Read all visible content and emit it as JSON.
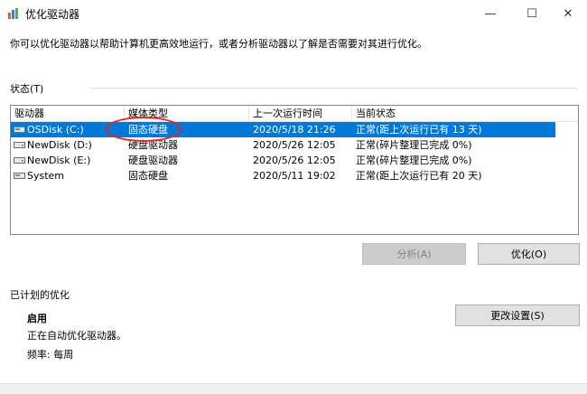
{
  "window": {
    "title": "优化驱动器",
    "minimize": "—",
    "maximize": "☐",
    "close": "✕"
  },
  "intro": "你可以优化驱动器以帮助计算机更高效地运行，或者分析驱动器以了解是否需要对其进行优化。",
  "status_label": "状态(T)",
  "columns": [
    "驱动器",
    "媒体类型",
    "上一次运行时间",
    "当前状态"
  ],
  "drives": [
    {
      "name": "OSDisk (C:)",
      "media": "固态硬盘",
      "last_run": "2020/5/18 21:26",
      "status": "正常(距上次运行已有 13 天)",
      "icon": "ssd-drive-icon"
    },
    {
      "name": "NewDisk (D:)",
      "media": "硬盘驱动器",
      "last_run": "2020/5/26 12:05",
      "status": "正常(碎片整理已完成 0%)",
      "icon": "hdd-drive-icon"
    },
    {
      "name": "NewDisk (E:)",
      "media": "硬盘驱动器",
      "last_run": "2020/5/26 12:05",
      "status": "正常(碎片整理已完成 0%)",
      "icon": "hdd-drive-icon"
    },
    {
      "name": "System",
      "media": "固态硬盘",
      "last_run": "2020/5/11 19:02",
      "status": "正常(距上次运行已有 20 天)",
      "icon": "ssd-drive-icon"
    }
  ],
  "buttons": {
    "analyze": "分析(A)",
    "optimize": "优化(O)",
    "change_settings": "更改设置(S)"
  },
  "scheduled": {
    "label": "已计划的优化",
    "state": "启用",
    "auto_text": "正在自动优化驱动器。",
    "frequency": "频率: 每周"
  },
  "colors": {
    "selection": "#0078d7",
    "annotation": "#e0242b"
  }
}
